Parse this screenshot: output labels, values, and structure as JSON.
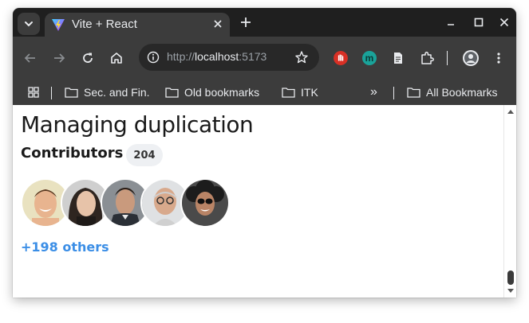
{
  "browser": {
    "tab": {
      "title": "Vite + React"
    },
    "address_bar": {
      "url_scheme": "http://",
      "url_host": "localhost",
      "url_port": ":5173"
    },
    "bookmarks": [
      {
        "label": "Sec. and Fin."
      },
      {
        "label": "Old bookmarks"
      },
      {
        "label": "ITK"
      }
    ],
    "overflow_label": "»",
    "all_bookmarks_label": "All Bookmarks",
    "extensions": [
      {
        "name": "stop-hand-icon",
        "color": "#d93025"
      },
      {
        "name": "m-extension-icon",
        "color": "#1aa39a",
        "letter": "m"
      },
      {
        "name": "document-icon",
        "color": "#e8eaed"
      },
      {
        "name": "puzzle-icon",
        "color": "#e8eaed"
      }
    ]
  },
  "page": {
    "heading": "Managing duplication",
    "contributors_label": "Contributors",
    "contributors_count": "204",
    "others_link": "+198 others",
    "avatars": [
      {
        "name": "contributor-avatar-1"
      },
      {
        "name": "contributor-avatar-2"
      },
      {
        "name": "contributor-avatar-3"
      },
      {
        "name": "contributor-avatar-4"
      },
      {
        "name": "contributor-avatar-5"
      }
    ]
  },
  "colors": {
    "link": "#3b8ee6",
    "chrome_dark": "#1f1f1f",
    "chrome_toolbar": "#3c3c3c"
  }
}
